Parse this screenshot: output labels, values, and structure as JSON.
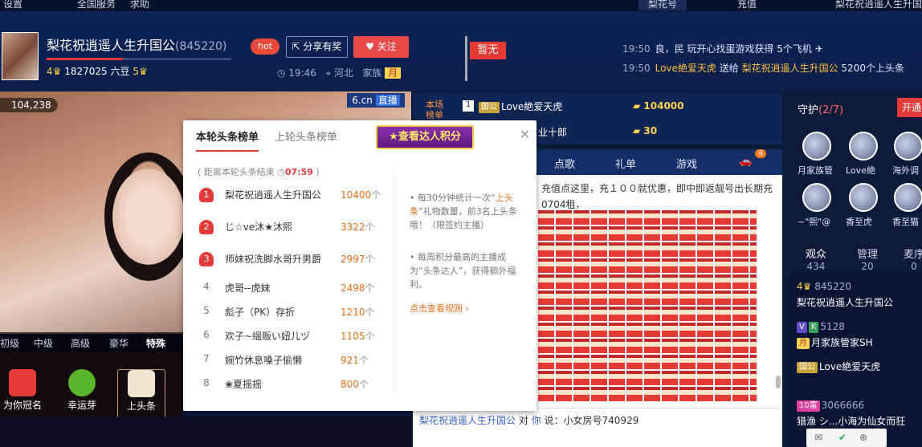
{
  "topnav": {
    "settings": "设置",
    "service": "全国服务",
    "message": "求助",
    "nickname": "梨花号",
    "recharge": "充值",
    "user": "梨花祝逍遥人生升国公"
  },
  "header": {
    "title": "梨花祝逍遥人生升国公",
    "room_id": "(845220)",
    "beans": "1827025 六豆",
    "level_left": "4",
    "level_right": "5",
    "hot_label": "hot",
    "share_label": "分享有奖",
    "follow_label": "关注",
    "time": "19:46",
    "location": "河北",
    "family": "家族",
    "month_badge": "月",
    "flag_label": "暂无"
  },
  "feed": [
    {
      "time": "19:50",
      "text": "良，民 玩开心找蛋游戏获得 5个飞机"
    },
    {
      "time": "19:50",
      "user": "Love絶爱天虎",
      "mid": "送给",
      "target": "梨花祝逍遥人生升国公",
      "gift": "5200个上头条"
    }
  ],
  "video": {
    "viewers": "104,238",
    "logo": "6.cn",
    "live": "直播"
  },
  "gift_tabs": [
    "初级",
    "中级",
    "高级",
    "豪华",
    "特殊"
  ],
  "gifts": [
    {
      "label": "为你冠名",
      "icon": "crown-icon"
    },
    {
      "label": "幸运芽",
      "icon": "sprout-icon"
    },
    {
      "label": "上头条",
      "icon": "headline-icon"
    }
  ],
  "popup": {
    "tab_current": "本轮头条榜单",
    "tab_last": "上轮头条榜单",
    "view_button": "查看达人积分",
    "timer_prefix": "( 距离本轮头条结束",
    "timer_value": "07:59",
    "timer_suffix": ")",
    "rows": [
      {
        "rank": "1",
        "name": "梨花祝逍遥人生升国公",
        "value": "10400",
        "unit": "个"
      },
      {
        "rank": "2",
        "name": "じ☆ve沐★沐熙",
        "value": "3322",
        "unit": "个"
      },
      {
        "rank": "3",
        "name": "师妹祝洗脚水哥升男爵",
        "value": "2997",
        "unit": "个"
      },
      {
        "rank": "4",
        "name": "虎哥--虎妹",
        "value": "2498",
        "unit": "个"
      },
      {
        "rank": "5",
        "name": "彪子（PK）存折",
        "value": "1210",
        "unit": "个"
      },
      {
        "rank": "6",
        "name": "欢子~縕贩い妞儿ヅ",
        "value": "1105",
        "unit": "个"
      },
      {
        "rank": "7",
        "name": "婉竹休息嗓子偷懒",
        "value": "921",
        "unit": "个"
      },
      {
        "rank": "8",
        "name": "❀夏摇摇",
        "value": "800",
        "unit": "个"
      }
    ],
    "note1_a": "每30分钟统计一次“",
    "note1_hl": "上头条",
    "note1_b": "”礼物数量，前3名上头条哦！（限签约主播）",
    "note2": "每周积分最高的主播成为“头条达人”，获得额外福利。",
    "rule_link": "点击查看规则 ›"
  },
  "rank": {
    "label": "本场榜单",
    "r1_rank": "1",
    "r1_tag": "国公",
    "r1_name": "Love絶爱天虎",
    "r1_value": "104000",
    "r2_name": "业十郎",
    "r2_value": "30"
  },
  "menu": [
    "点歌",
    "礼单",
    "游戏"
  ],
  "menu_badge": "4",
  "chat": {
    "notice": "充值点这里，充１００就优惠，即中即返靓号出长期充",
    "notice2": "0704租，",
    "line_user": "梨花祝逍遥人生升国公",
    "line_mid": "对",
    "line_you": "你",
    "line_text": "说：小女房号740929"
  },
  "guard": {
    "title": "守护",
    "count": "(2/7)",
    "open": "开通",
    "members": [
      {
        "name": "月家族管"
      },
      {
        "name": "Love絶"
      },
      {
        "name": "海外调"
      },
      {
        "name": "~\"熙\"@"
      },
      {
        "name": "香至虎"
      },
      {
        "name": "香至猫"
      }
    ]
  },
  "aud_tabs": [
    {
      "label": "观众",
      "count": "434"
    },
    {
      "label": "管理",
      "count": "20"
    },
    {
      "label": "麦序",
      "count": "0"
    }
  ],
  "users": [
    {
      "level": "4",
      "id": "845220",
      "name": "梨花祝逍遥人生升国公"
    },
    {
      "id": "5128",
      "name": "月家族管家SH",
      "tag": "月"
    },
    {
      "name": "Love絶爱天虎",
      "tag": "国公"
    },
    {
      "id": "3066666",
      "name": "猎渔 シ...小海为仙女而狂",
      "tag": "10富"
    }
  ]
}
